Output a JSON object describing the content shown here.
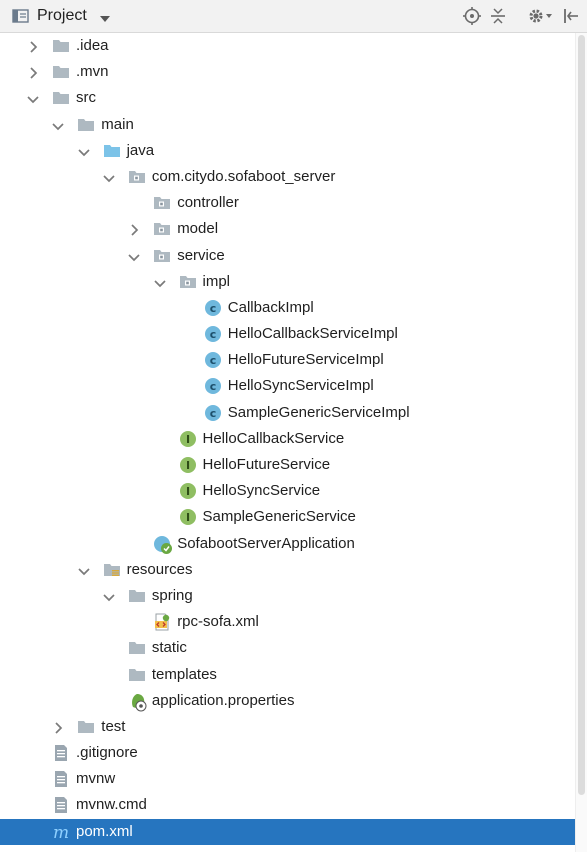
{
  "header": {
    "title": "Project",
    "tools": [
      {
        "name": "locate-icon"
      },
      {
        "name": "collapse-all-icon"
      },
      {
        "name": "settings-icon"
      },
      {
        "name": "hide-icon"
      }
    ]
  },
  "tree": [
    {
      "label": ".idea",
      "depth": 0,
      "arrow": "collapsed",
      "icon": "folder-icon"
    },
    {
      "label": ".mvn",
      "depth": 0,
      "arrow": "collapsed",
      "icon": "folder-icon"
    },
    {
      "label": "src",
      "depth": 0,
      "arrow": "expanded",
      "icon": "folder-icon"
    },
    {
      "label": "main",
      "depth": 1,
      "arrow": "expanded",
      "icon": "folder-icon"
    },
    {
      "label": "java",
      "depth": 2,
      "arrow": "expanded",
      "icon": "source-folder-icon"
    },
    {
      "label": "com.citydo.sofaboot_server",
      "depth": 3,
      "arrow": "expanded",
      "icon": "package-icon"
    },
    {
      "label": "controller",
      "depth": 4,
      "arrow": "none",
      "icon": "package-icon"
    },
    {
      "label": "model",
      "depth": 4,
      "arrow": "collapsed",
      "icon": "package-icon"
    },
    {
      "label": "service",
      "depth": 4,
      "arrow": "expanded",
      "icon": "package-icon"
    },
    {
      "label": "impl",
      "depth": 5,
      "arrow": "expanded",
      "icon": "package-icon"
    },
    {
      "label": "CallbackImpl",
      "depth": 6,
      "arrow": "none",
      "icon": "class-icon"
    },
    {
      "label": "HelloCallbackServiceImpl",
      "depth": 6,
      "arrow": "none",
      "icon": "class-icon"
    },
    {
      "label": "HelloFutureServiceImpl",
      "depth": 6,
      "arrow": "none",
      "icon": "class-icon"
    },
    {
      "label": "HelloSyncServiceImpl",
      "depth": 6,
      "arrow": "none",
      "icon": "class-icon"
    },
    {
      "label": "SampleGenericServiceImpl",
      "depth": 6,
      "arrow": "none",
      "icon": "class-icon"
    },
    {
      "label": "HelloCallbackService",
      "depth": 5,
      "arrow": "none",
      "icon": "interface-icon"
    },
    {
      "label": "HelloFutureService",
      "depth": 5,
      "arrow": "none",
      "icon": "interface-icon"
    },
    {
      "label": "HelloSyncService",
      "depth": 5,
      "arrow": "none",
      "icon": "interface-icon"
    },
    {
      "label": "SampleGenericService",
      "depth": 5,
      "arrow": "none",
      "icon": "interface-icon"
    },
    {
      "label": "SofabootServerApplication",
      "depth": 4,
      "arrow": "none",
      "icon": "spring-boot-class-icon"
    },
    {
      "label": "resources",
      "depth": 2,
      "arrow": "expanded",
      "icon": "resources-folder-icon"
    },
    {
      "label": "spring",
      "depth": 3,
      "arrow": "expanded",
      "icon": "folder-icon"
    },
    {
      "label": "rpc-sofa.xml",
      "depth": 4,
      "arrow": "none",
      "icon": "xml-file-icon"
    },
    {
      "label": "static",
      "depth": 3,
      "arrow": "none",
      "icon": "folder-icon"
    },
    {
      "label": "templates",
      "depth": 3,
      "arrow": "none",
      "icon": "folder-icon"
    },
    {
      "label": "application.properties",
      "depth": 3,
      "arrow": "none",
      "icon": "spring-properties-icon"
    },
    {
      "label": "test",
      "depth": 1,
      "arrow": "collapsed",
      "icon": "folder-icon"
    },
    {
      "label": ".gitignore",
      "depth": 0,
      "arrow": "none",
      "icon": "text-file-icon"
    },
    {
      "label": "mvnw",
      "depth": 0,
      "arrow": "none",
      "icon": "text-file-icon"
    },
    {
      "label": "mvnw.cmd",
      "depth": 0,
      "arrow": "none",
      "icon": "text-file-icon"
    },
    {
      "label": "pom.xml",
      "depth": 0,
      "arrow": "none",
      "icon": "maven-icon",
      "selected": true
    }
  ],
  "colors": {
    "selection": "#2675bf",
    "folder": "#aeb9c1",
    "source_folder": "#7cc3e8",
    "class_badge": "#6fb8dd",
    "interface_badge": "#8fbe62",
    "spring_green": "#6aa842"
  }
}
